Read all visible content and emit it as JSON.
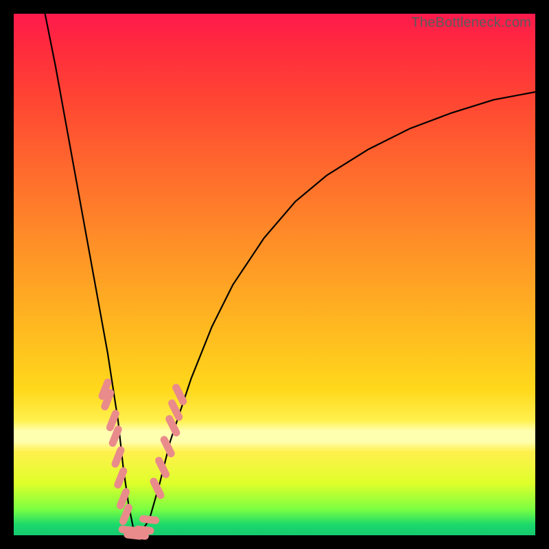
{
  "watermark": "TheBottleneck.com",
  "chart_data": {
    "type": "line",
    "title": "",
    "xlabel": "",
    "ylabel": "",
    "xlim": [
      0,
      100
    ],
    "ylim": [
      0,
      100
    ],
    "grid": false,
    "legend": null,
    "series": [
      {
        "name": "bottleneck-curve",
        "color": "#000000",
        "x": [
          6,
          8,
          10,
          12,
          14,
          16,
          18,
          20,
          21,
          22,
          23,
          24,
          26,
          28,
          30,
          34,
          38,
          42,
          48,
          54,
          60,
          68,
          76,
          84,
          92,
          100
        ],
        "y": [
          100,
          90,
          79,
          68,
          57,
          46,
          35,
          22,
          13,
          6,
          1,
          0,
          3,
          10,
          18,
          30,
          40,
          48,
          57,
          64,
          69,
          74,
          78,
          81,
          83.5,
          85
        ]
      },
      {
        "name": "sample-markers-left",
        "color": "#e98b8b",
        "type": "scatter",
        "x": [
          17.5,
          18.0,
          19.0,
          19.5,
          20.0,
          20.5,
          21.0,
          21.5
        ],
        "y": [
          28,
          26,
          22,
          19,
          15,
          11,
          7,
          4
        ]
      },
      {
        "name": "sample-markers-bottom",
        "color": "#e98b8b",
        "type": "scatter",
        "x": [
          22.0,
          23.0,
          24.0,
          25.0,
          26.0
        ],
        "y": [
          1,
          0,
          0,
          1,
          3
        ]
      },
      {
        "name": "sample-markers-right",
        "color": "#e98b8b",
        "type": "scatter",
        "x": [
          27.5,
          28.5,
          29.5,
          30.5,
          31.0,
          31.8
        ],
        "y": [
          9,
          13,
          17,
          21,
          24,
          27
        ]
      }
    ],
    "gradient_bands": [
      {
        "y": 100,
        "color": "#ff1a4d"
      },
      {
        "y": 72,
        "color": "#ff8f27"
      },
      {
        "y": 28,
        "color": "#ffd81b"
      },
      {
        "y": 19,
        "color": "#ffffb0"
      },
      {
        "y": 5,
        "color": "#7bff42"
      },
      {
        "y": 0,
        "color": "#14c96f"
      }
    ]
  }
}
